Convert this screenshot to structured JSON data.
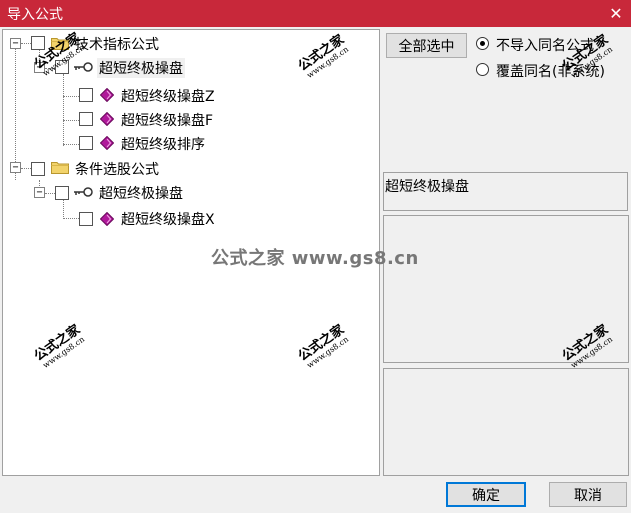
{
  "window": {
    "title": "导入公式",
    "close_glyph": "✕"
  },
  "tree": {
    "groups": [
      {
        "label": "技术指标公式",
        "expander": "−",
        "children": [
          {
            "label": "超短终极操盘",
            "expander": "−",
            "selected": true,
            "children": [
              {
                "label": "超短终级操盘Z"
              },
              {
                "label": "超短终级操盘F"
              },
              {
                "label": "超短终级排序"
              }
            ]
          }
        ]
      },
      {
        "label": "条件选股公式",
        "expander": "−",
        "children": [
          {
            "label": "超短终极操盘",
            "expander": "−",
            "children": [
              {
                "label": "超短终级操盘X"
              }
            ]
          }
        ]
      }
    ]
  },
  "right_panel": {
    "select_all_label": "全部选中",
    "options": [
      {
        "label": "不导入同名公式",
        "checked": true
      },
      {
        "label": "覆盖同名(非系统)",
        "checked": false
      }
    ],
    "selected_name": "超短终极操盘"
  },
  "footer": {
    "ok_label": "确定",
    "cancel_label": "取消"
  },
  "watermarks": {
    "cn": "公式之家",
    "url": "www.gs8.cn",
    "center": "公式之家 www.gs8.cn"
  },
  "colors": {
    "titlebar": "#c8283a",
    "gem": "#b0189a",
    "folder": "#f2d36b"
  }
}
